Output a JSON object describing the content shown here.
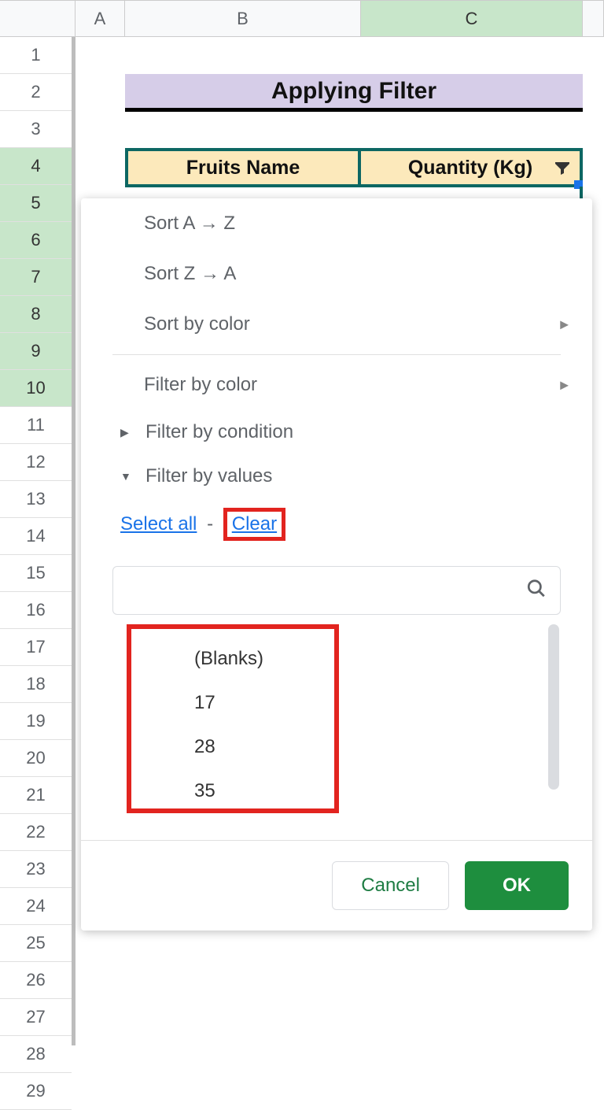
{
  "columns": [
    "A",
    "B",
    "C"
  ],
  "rows": [
    "1",
    "2",
    "3",
    "4",
    "5",
    "6",
    "7",
    "8",
    "9",
    "10",
    "11",
    "12",
    "13",
    "14",
    "15",
    "16",
    "17",
    "18",
    "19",
    "20",
    "21",
    "22",
    "23",
    "24",
    "25",
    "26",
    "27",
    "28",
    "29"
  ],
  "selected_row": "4",
  "title": "Applying Filter",
  "table_headers": {
    "b": "Fruits Name",
    "c": "Quantity (Kg)"
  },
  "filter_menu": {
    "sort_az": "Sort A → Z",
    "sort_za": "Sort Z → A",
    "sort_color": "Sort by color",
    "filter_color": "Filter by color",
    "filter_condition": "Filter by condition",
    "filter_values": "Filter by values",
    "select_all": "Select all",
    "dash": "-",
    "clear": "Clear",
    "search_placeholder": "",
    "values": [
      "(Blanks)",
      "17",
      "28",
      "35"
    ],
    "cancel": "Cancel",
    "ok": "OK"
  }
}
